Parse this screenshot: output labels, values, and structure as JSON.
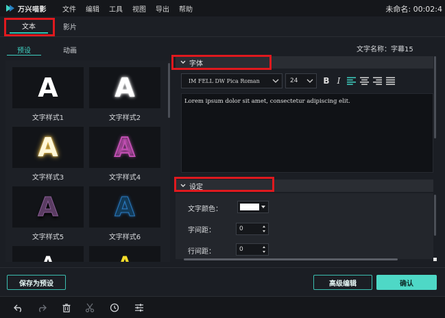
{
  "app": {
    "logo_text": "万兴喵影",
    "project_name": "未命名: 00:02:4"
  },
  "menu": [
    "文件",
    "编辑",
    "工具",
    "视图",
    "导出",
    "帮助"
  ],
  "tabs": {
    "text": "文本",
    "movie": "影片"
  },
  "subtabs": {
    "preset": "预设",
    "animation": "动画"
  },
  "presets": [
    {
      "label": "文字样式1",
      "glyph": "A"
    },
    {
      "label": "文字样式2",
      "glyph": "A"
    },
    {
      "label": "文字样式3",
      "glyph": "A"
    },
    {
      "label": "文字样式4",
      "glyph": "A"
    },
    {
      "label": "文字样式5",
      "glyph": "A"
    },
    {
      "label": "文字样式6",
      "glyph": "A"
    },
    {
      "label": "",
      "glyph": "A"
    },
    {
      "label": "",
      "glyph": "A"
    }
  ],
  "text_name": {
    "label": "文字名称：",
    "value": "字幕15"
  },
  "font_section": {
    "title": "字体",
    "font_family": "IM FELL DW Pica Roman",
    "font_size": "24",
    "bold": "B",
    "italic": "I",
    "content": "Lorem ipsum dolor sit amet, consectetur adipiscing elit."
  },
  "settings_section": {
    "title": "设定",
    "color_label": "文字颜色：",
    "color_value": "#ffffff",
    "spacing_label": "字间距：",
    "spacing_value": "0",
    "line_spacing_label": "行间距：",
    "line_spacing_value": "0"
  },
  "buttons": {
    "save_preset": "保存为预设",
    "advanced_edit": "高级编辑",
    "confirm": "确认"
  },
  "bottom_icons": [
    "undo-icon",
    "redo-icon",
    "delete-icon",
    "cut-icon",
    "clock-icon",
    "adjust-icon"
  ],
  "colors": {
    "accent": "#4ed8c6",
    "highlight": "#e0191e"
  }
}
